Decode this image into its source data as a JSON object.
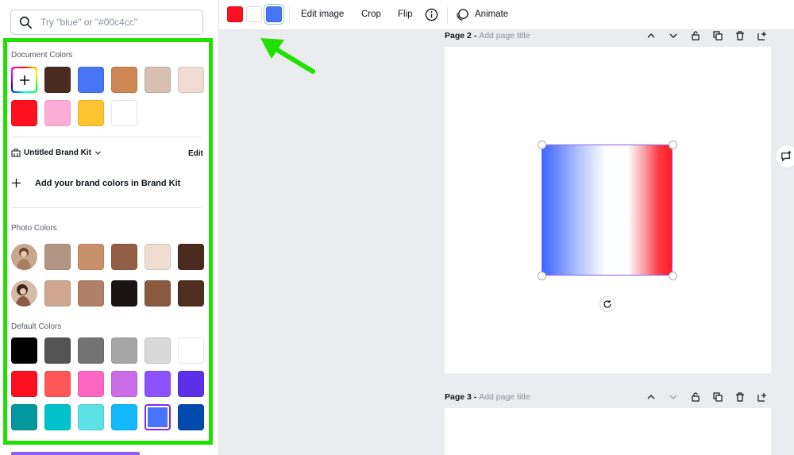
{
  "search": {
    "placeholder": "Try \"blue\" or \"#00c4cc\"",
    "icon": "search-icon"
  },
  "document_colors": {
    "title": "Document Colors",
    "add_icon": "plus-icon",
    "swatches": [
      "#4a2b1f",
      "#4775f5",
      "#cf8655",
      "#d7bfb1",
      "#f0dcd2",
      "#ff101e",
      "#ffadd8",
      "#ffc42f",
      "#ffffff"
    ]
  },
  "brand_kit": {
    "name": "Untitled Brand Kit",
    "edit": "Edit",
    "add_text": "Add your brand colors in Brand Kit"
  },
  "photo_colors": {
    "title": "Photo Colors",
    "rows": [
      [
        "#b29685",
        "#c9916a",
        "#945e44",
        "#f0ddd2",
        "#4c2b1f"
      ],
      [
        "#cfa791",
        "#b07f68",
        "#1a1514",
        "#8a5a40",
        "#4f2d1f"
      ]
    ]
  },
  "default_colors": {
    "title": "Default Colors",
    "rows": [
      [
        "#000000",
        "#545454",
        "#737373",
        "#a6a6a6",
        "#d9d9d9",
        "#ffffff"
      ],
      [
        "#ff1020",
        "#ff5757",
        "#ff66c4",
        "#cb6ce6",
        "#8c52ff",
        "#5e2fe8"
      ],
      [
        "#03989e",
        "#00c2cb",
        "#5ce1e6",
        "#12b9ff",
        "#4775ff",
        "#004aad"
      ]
    ],
    "selected": "#4775ff"
  },
  "toolbar": {
    "colors": [
      "#ff1020",
      "#ffffff",
      "#4775f5"
    ],
    "edit_image": "Edit image",
    "crop": "Crop",
    "flip": "Flip",
    "animate": "Animate"
  },
  "pages": [
    {
      "label": "Page 2 - ",
      "title_placeholder": "Add page title"
    },
    {
      "label": "Page 3 - ",
      "title_placeholder": "Add page title"
    }
  ],
  "accent": "#1fe100"
}
